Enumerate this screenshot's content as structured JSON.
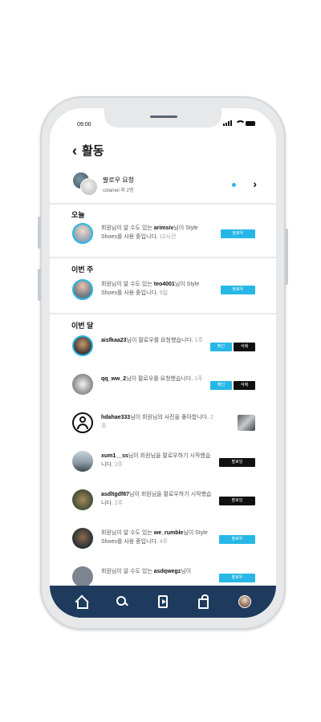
{
  "status": {
    "time": "09:00"
  },
  "header": {
    "back_icon": "chevron-left",
    "title": "활동"
  },
  "follow_request": {
    "title": "팔로우 요청",
    "subtitle": "colamel 외 2명",
    "indicator_color": "#27b7e6",
    "chevron": "›"
  },
  "sections": {
    "today": "오늘",
    "this_week": "이번 주",
    "this_month": "이번 달"
  },
  "today": [
    {
      "pre": "회원님이 알 수도 있는 ",
      "user": "arimsiv",
      "post": "님이 Style Shoes를 사용 중입니다.",
      "time": "12시간",
      "button": "팔로우"
    }
  ],
  "this_week": [
    {
      "pre": "회원님이 알 수도 있는 ",
      "user": "teo4001",
      "post": "님이 Style Shoes를 사용 중입니다.",
      "time": "5일",
      "button": "팔로우"
    }
  ],
  "this_month": [
    {
      "user": "aisfkaa23",
      "text": "님이 팔로우를 요청했습니다.",
      "time": "1주",
      "buttons": [
        "확인",
        "삭제"
      ]
    },
    {
      "user": "qq_ww_2",
      "text": "님이 팔로우를 요청했습니다.",
      "time": "1주",
      "buttons": [
        "확인",
        "삭제"
      ]
    },
    {
      "user": "hdahae333",
      "text": "님이 회원님의 사진을 좋아합니다.",
      "time": "2주"
    },
    {
      "user": "xum1__ss",
      "text": "님이 회원님을 팔로우하기 시작했습니다.",
      "time": "2주",
      "button": "팔로잉"
    },
    {
      "user": "asdltgdf87",
      "text": "님이 회원님을 팔로우하기 시작했습니다.",
      "time": "2주",
      "button": "팔로잉"
    },
    {
      "pre": "회원님이 알 수도 있는 ",
      "user": "we_rumble",
      "post": "님이 Style Shoes를 사용 중입니다.",
      "time": "4주",
      "button": "팔로우"
    },
    {
      "pre": "회원님이 알 수도 있는 ",
      "user": "asdqwegz",
      "post": "님이",
      "time": "",
      "button": "팔로우"
    }
  ],
  "tabbar": {
    "background": "#1e3a5c",
    "tabs": [
      "home-icon",
      "search-icon",
      "video-icon",
      "bag-icon",
      "profile-avatar"
    ]
  },
  "colors": {
    "accent": "#27b7e6",
    "dark": "#111111"
  }
}
